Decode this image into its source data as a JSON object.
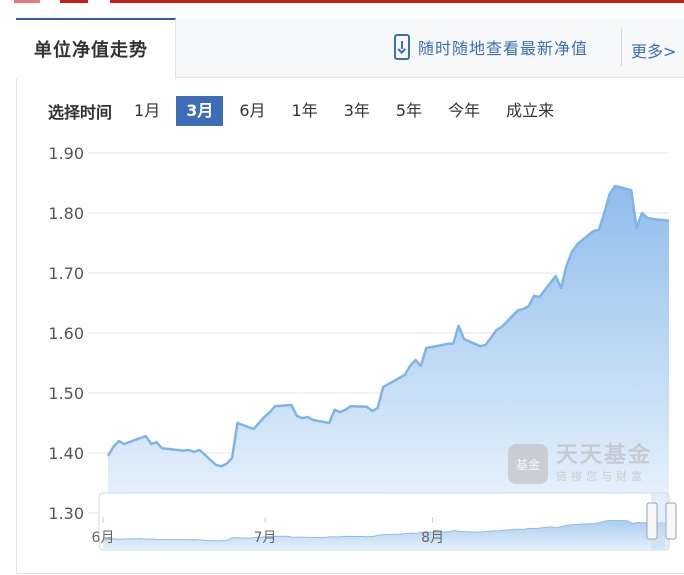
{
  "header": {
    "tab_title": "单位净值走势",
    "mobile_link": "随时随地查看最新净值",
    "more_link": "更多>"
  },
  "range": {
    "label": "选择时间",
    "options": [
      "1月",
      "3月",
      "6月",
      "1年",
      "3年",
      "5年",
      "今年",
      "成立来"
    ],
    "selected": "3月"
  },
  "watermark": {
    "logo_text": "基金",
    "name": "天天基金",
    "slogan": "链接您与财富"
  },
  "colors": {
    "line": "#7fb4e8",
    "fill_top": "#b9d7f4",
    "accent": "#3d6db6"
  },
  "chart_data": {
    "type": "area",
    "title": "单位净值走势",
    "ylim": [
      1.3,
      1.9
    ],
    "y_ticks": [
      "1.90",
      "1.80",
      "1.70",
      "1.60",
      "1.50",
      "1.40",
      "1.30"
    ],
    "grid": true,
    "x_range": [
      "2021-06-01",
      "2021-09-01"
    ],
    "series": [
      {
        "values": [
          [
            "2021-06-01",
            1.395
          ],
          [
            "2021-06-02",
            1.41
          ],
          [
            "2021-06-03",
            1.42
          ],
          [
            "2021-06-04",
            1.415
          ],
          [
            "2021-06-07",
            1.425
          ],
          [
            "2021-06-08",
            1.428
          ],
          [
            "2021-06-09",
            1.415
          ],
          [
            "2021-06-10",
            1.418
          ],
          [
            "2021-06-11",
            1.408
          ],
          [
            "2021-06-15",
            1.404
          ],
          [
            "2021-06-16",
            1.405
          ],
          [
            "2021-06-17",
            1.402
          ],
          [
            "2021-06-18",
            1.405
          ],
          [
            "2021-06-21",
            1.38
          ],
          [
            "2021-06-22",
            1.378
          ],
          [
            "2021-06-23",
            1.382
          ],
          [
            "2021-06-24",
            1.392
          ],
          [
            "2021-06-25",
            1.45
          ],
          [
            "2021-06-28",
            1.44
          ],
          [
            "2021-06-29",
            1.45
          ],
          [
            "2021-06-30",
            1.46
          ],
          [
            "2021-07-01",
            1.468
          ],
          [
            "2021-07-02",
            1.478
          ],
          [
            "2021-07-05",
            1.48
          ],
          [
            "2021-07-06",
            1.462
          ],
          [
            "2021-07-07",
            1.458
          ],
          [
            "2021-07-08",
            1.46
          ],
          [
            "2021-07-09",
            1.455
          ],
          [
            "2021-07-12",
            1.45
          ],
          [
            "2021-07-13",
            1.472
          ],
          [
            "2021-07-14",
            1.468
          ],
          [
            "2021-07-15",
            1.472
          ],
          [
            "2021-07-16",
            1.478
          ],
          [
            "2021-07-19",
            1.477
          ],
          [
            "2021-07-20",
            1.47
          ],
          [
            "2021-07-21",
            1.475
          ],
          [
            "2021-07-22",
            1.51
          ],
          [
            "2021-07-23",
            1.515
          ],
          [
            "2021-07-26",
            1.53
          ],
          [
            "2021-07-27",
            1.545
          ],
          [
            "2021-07-28",
            1.555
          ],
          [
            "2021-07-29",
            1.545
          ],
          [
            "2021-07-30",
            1.575
          ],
          [
            "2021-08-02",
            1.58
          ],
          [
            "2021-08-03",
            1.582
          ],
          [
            "2021-08-04",
            1.582
          ],
          [
            "2021-08-05",
            1.612
          ],
          [
            "2021-08-06",
            1.59
          ],
          [
            "2021-08-09",
            1.578
          ],
          [
            "2021-08-10",
            1.58
          ],
          [
            "2021-08-11",
            1.592
          ],
          [
            "2021-08-12",
            1.605
          ],
          [
            "2021-08-13",
            1.61
          ],
          [
            "2021-08-16",
            1.638
          ],
          [
            "2021-08-17",
            1.64
          ],
          [
            "2021-08-18",
            1.645
          ],
          [
            "2021-08-19",
            1.662
          ],
          [
            "2021-08-20",
            1.66
          ],
          [
            "2021-08-23",
            1.695
          ],
          [
            "2021-08-24",
            1.675
          ],
          [
            "2021-08-25",
            1.712
          ],
          [
            "2021-08-26",
            1.735
          ],
          [
            "2021-08-27",
            1.748
          ],
          [
            "2021-08-30",
            1.77
          ],
          [
            "2021-08-31",
            1.772
          ],
          [
            "2021-09-01",
            1.8
          ],
          [
            "2021-09-02",
            1.832
          ],
          [
            "2021-09-03",
            1.845
          ],
          [
            "2021-09-06",
            1.838
          ],
          [
            "2021-09-07",
            1.775
          ],
          [
            "2021-09-08",
            1.8
          ],
          [
            "2021-09-09",
            1.792
          ],
          [
            "2021-09-10",
            1.79
          ],
          [
            "2021-09-13",
            1.787
          ]
        ]
      }
    ],
    "navigator": {
      "x_tick_labels": [
        "6月",
        "7月",
        "8月"
      ]
    }
  }
}
